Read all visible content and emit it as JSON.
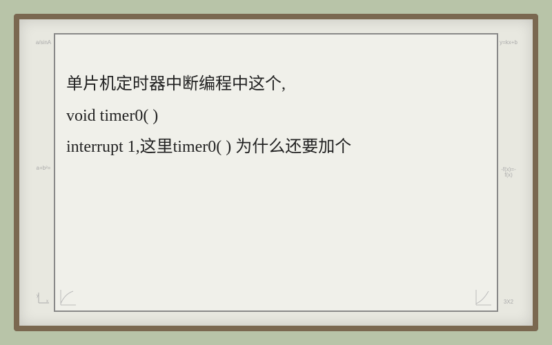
{
  "text": {
    "line1": "单片机定时器中断编程中这个,",
    "line2": "void timer0( )",
    "line3": " interrupt 1,这里timer0( ) 为什么还要加个"
  },
  "margin": {
    "top_left": "a/sinA",
    "mid_left": "a+b²=",
    "top_right": "y=kx+b",
    "mid_right": "-f(x)=-f(x)"
  }
}
